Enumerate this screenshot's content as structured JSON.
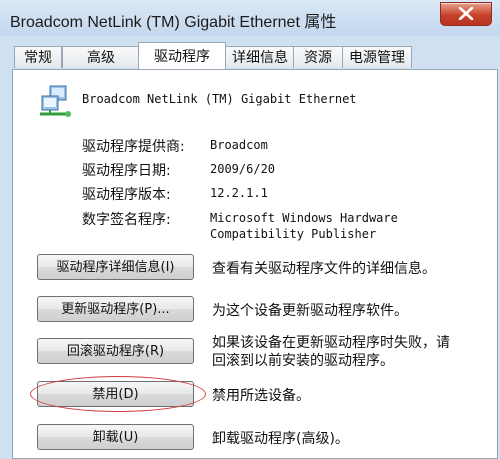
{
  "window": {
    "title": "Broadcom NetLink (TM) Gigabit Ethernet 属性"
  },
  "tabs": [
    {
      "label": "常规"
    },
    {
      "label": "高级"
    },
    {
      "label": "驱动程序"
    },
    {
      "label": "详细信息"
    },
    {
      "label": "资源"
    },
    {
      "label": "电源管理"
    }
  ],
  "active_tab": "驱动程序",
  "device": {
    "name": "Broadcom NetLink (TM) Gigabit Ethernet",
    "icon": "network-adapter-icon"
  },
  "info": [
    {
      "label": "驱动程序提供商:",
      "value": "Broadcom"
    },
    {
      "label": "驱动程序日期:",
      "value": "2009/6/20"
    },
    {
      "label": "驱动程序版本:",
      "value": "12.2.1.1"
    },
    {
      "label": "数字签名程序:",
      "value_line1": "Microsoft Windows Hardware",
      "value_line2": "Compatibility Publisher"
    }
  ],
  "actions": [
    {
      "button": "驱动程序详细信息(I)",
      "description": "查看有关驱动程序文件的详细信息。"
    },
    {
      "button": "更新驱动程序(P)...",
      "description": "为这个设备更新驱动程序软件。"
    },
    {
      "button": "回滚驱动程序(R)",
      "description_line1": "如果该设备在更新驱动程序时失败，请",
      "description_line2": "回滚到以前安装的驱动程序。"
    },
    {
      "button": "禁用(D)",
      "description": "禁用所选设备。"
    },
    {
      "button": "卸载(U)",
      "description": "卸载驱动程序(高级)。"
    }
  ],
  "colors": {
    "window_frame": "#cfe0f1",
    "close_button": "#c7432c",
    "highlight_oval": "#d23a3a"
  }
}
